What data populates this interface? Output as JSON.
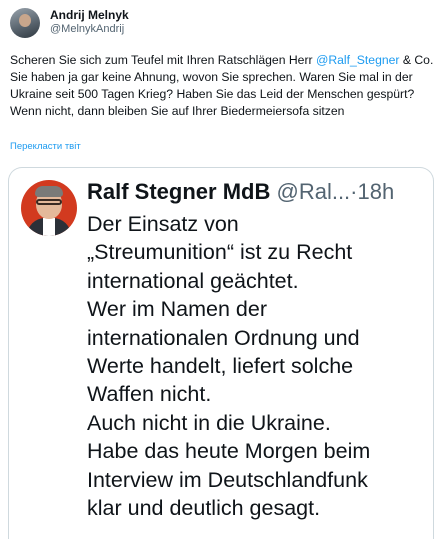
{
  "tweet": {
    "author": {
      "display_name": "Andrij Melnyk",
      "handle": "@MelnykAndrij"
    },
    "text_part1": "Scheren Sie sich zum Teufel mit Ihren Ratschlägen Herr ",
    "mention": "@Ralf_Stegner",
    "text_part2": " & Co.",
    "text_paragraph2": "Sie haben ja gar keine Ahnung, wovon Sie sprechen. Waren Sie mal in der Ukraine seit 500 Tagen Krieg? Haben Sie das Leid der Menschen gespürt? Wenn nicht, dann bleiben Sie auf Ihrer Biedermeiersofa sitzen",
    "translate_label": "Перекласти твіт"
  },
  "quoted_tweet": {
    "display_name": "Ralf Stegner MdB",
    "handle": "@Ral...",
    "separator": "·",
    "time": "18h",
    "lines": [
      "Der Einsatz von",
      "„Streumunition“ ist zu Recht",
      "international geächtet.",
      "Wer im Namen der",
      "internationalen Ordnung und",
      "Werte handelt, liefert solche",
      "Waffen nicht.",
      "Auch nicht in die Ukraine.",
      "Habe das heute Morgen beim",
      "Interview im Deutschlandfunk",
      "klar und deutlich gesagt."
    ]
  },
  "colors": {
    "link": "#1d9bf0",
    "text": "#0f1419",
    "secondary": "#536471",
    "border": "#cfd9de"
  }
}
